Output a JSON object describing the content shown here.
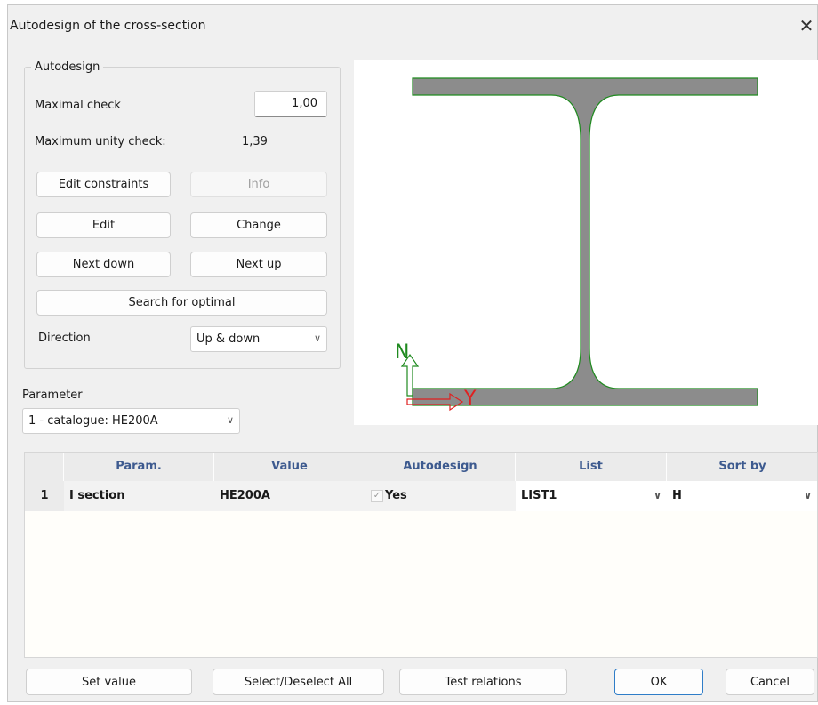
{
  "window": {
    "title": "Autodesign of the cross-section",
    "close_symbol": "✕"
  },
  "autodesign": {
    "legend": "Autodesign",
    "maximal_check_label": "Maximal check",
    "maximal_check_value": "1,00",
    "max_unity_label": "Maximum unity check:",
    "max_unity_value": "1,39",
    "edit_constraints": "Edit constraints",
    "info": "Info",
    "edit": "Edit",
    "change": "Change",
    "next_down": "Next down",
    "next_up": "Next up",
    "search_optimal": "Search for optimal",
    "direction_label": "Direction",
    "direction_value": "Up & down"
  },
  "parameter": {
    "label": "Parameter",
    "value": "1 - catalogue: HE200A"
  },
  "preview": {
    "axis_n": "N",
    "axis_y": "Y",
    "colors": {
      "section_fill": "#8c8c8c",
      "section_outline": "#1f8a1f",
      "axis_n": "#1f8a1f",
      "axis_y": "#e02020"
    }
  },
  "table": {
    "columns": [
      "Param.",
      "Value",
      "Autodesign",
      "List",
      "Sort by"
    ],
    "rows": [
      {
        "index": "1",
        "param": "I section",
        "value": "HE200A",
        "autodesign": "Yes",
        "list": "LIST1",
        "sort_by": "H"
      }
    ]
  },
  "footer": {
    "set_value": "Set value",
    "select_deselect": "Select/Deselect All",
    "test_relations": "Test relations",
    "ok": "OK",
    "cancel": "Cancel"
  },
  "icons": {
    "dropdown": "chevron-down-icon",
    "check": "checkmark-icon",
    "close": "close-icon"
  }
}
